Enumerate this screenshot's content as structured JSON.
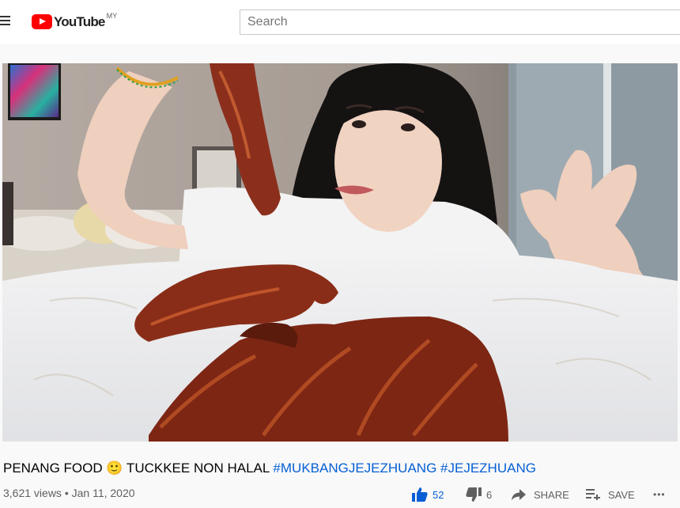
{
  "header": {
    "logo_text": "YouTube",
    "region": "MY",
    "search_placeholder": "Search"
  },
  "video": {
    "title_text": "PENANG FOOD 🙂 TUCKKEE NON HALAL",
    "hashtags": [
      "#MUKBANGJEJEZHUANG",
      "#JEJEZHUANG"
    ],
    "views": "3,621 views",
    "separator": "•",
    "date": "Jan 11, 2020"
  },
  "actions": {
    "likes": "52",
    "dislikes": "6",
    "share_label": "SHARE",
    "save_label": "SAVE",
    "more": "•••"
  },
  "colors": {
    "brand_red": "#ff0000",
    "link_blue": "#065fd4",
    "like_blue": "#065fd4"
  }
}
